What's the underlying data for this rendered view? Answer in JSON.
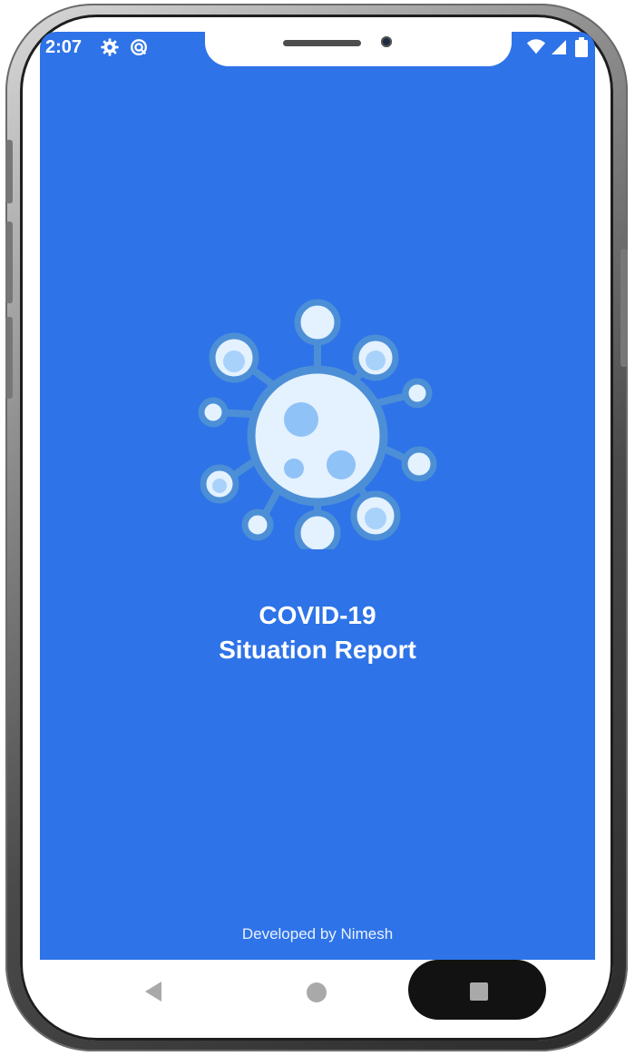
{
  "status_bar": {
    "time": "2:07",
    "icons": [
      "settings-gear-icon",
      "location-target-icon",
      "wifi-icon",
      "signal-icon",
      "battery-icon"
    ]
  },
  "splash": {
    "title_line1": "COVID-19",
    "title_line2": "Situation Report",
    "credit": "Developed by Nimesh",
    "logo_icon": "virus-icon"
  },
  "nav_bar": {
    "buttons": [
      "back-icon",
      "home-icon",
      "recents-icon"
    ]
  },
  "colors": {
    "background": "#2e73e8",
    "text": "#ffffff",
    "virus_body": "#e4f1ff",
    "virus_outline": "#4c8fd6",
    "virus_spots": "#8fc2f7"
  }
}
